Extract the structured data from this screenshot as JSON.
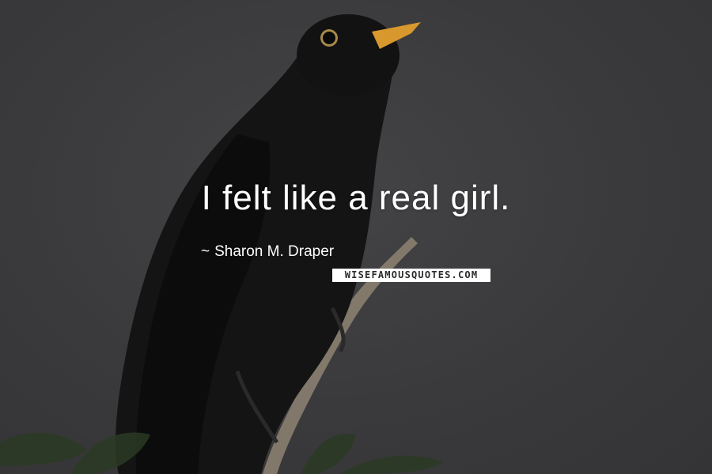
{
  "quote": {
    "text": "I felt like a real girl."
  },
  "author": {
    "dash": "~",
    "name": "Sharon M. Draper"
  },
  "watermark": {
    "text": "WISEFAMOUSQUOTES.COM"
  },
  "photo": {
    "subject": "black bird perched on branch",
    "colors": {
      "background": "#3b3b3d",
      "bird": "#141414",
      "beak": "#d9982e",
      "leaves": "#2c3a24",
      "branch": "#8a8070"
    }
  }
}
